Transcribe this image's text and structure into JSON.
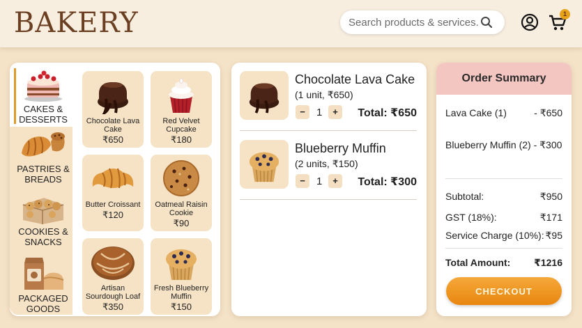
{
  "header": {
    "logo": "BAKERY",
    "search_placeholder": "Search products & services...",
    "cart_count": "1",
    "icons": {
      "search": "search-icon",
      "account": "user-circle-icon",
      "cart": "cart-icon"
    }
  },
  "categories": [
    {
      "label_line1": "CAKES &",
      "label_line2": "DESSERTS",
      "icon": "cake-icon",
      "active": true
    },
    {
      "label_line1": "PASTRIES &",
      "label_line2": "BREADS",
      "icon": "croissant-icon"
    },
    {
      "label_line1": "COOKIES &",
      "label_line2": "SNACKS",
      "icon": "cookie-box-icon"
    },
    {
      "label_line1": "PACKAGED",
      "label_line2": "GOODS",
      "icon": "package-icon"
    }
  ],
  "products": [
    {
      "name_line1": "Chocolate Lava",
      "name_line2": "Cake",
      "price": "₹650",
      "icon": "lava-cake-icon"
    },
    {
      "name_line1": "Red Velvet",
      "name_line2": "Cupcake",
      "price": "₹180",
      "icon": "cupcake-icon"
    },
    {
      "name_line1": "Butter Croissant",
      "name_line2": "",
      "price": "₹120",
      "icon": "croissant-icon"
    },
    {
      "name_line1": "Oatmeal Raisin",
      "name_line2": "Cookie",
      "price": "₹90",
      "icon": "cookie-icon"
    },
    {
      "name_line1": "Artisan",
      "name_line2": "Sourdough Loaf",
      "price": "₹350",
      "icon": "bread-loaf-icon"
    },
    {
      "name_line1": "Fresh Blueberry",
      "name_line2": "Muffin",
      "price": "₹150",
      "icon": "muffin-icon"
    }
  ],
  "cart_items": [
    {
      "name": "Chocolate Lava Cake",
      "detail": "(1 unit, ₹650)",
      "qty": "1",
      "total": "Total: ₹650",
      "minus": "−",
      "plus": "+"
    },
    {
      "name": "Blueberry Muffin",
      "detail": "(2 units, ₹150)",
      "qty": "1",
      "total": "Total: ₹300",
      "minus": "−",
      "plus": "+"
    }
  ],
  "summary": {
    "title": "Order Summary",
    "items": [
      {
        "label": "Lava Cake (1)",
        "value": "- ₹650"
      },
      {
        "label": "Blueberry Muffin (2) - ₹300",
        "value": ""
      }
    ],
    "subtotal_label": "Subtotal:",
    "subtotal_value": "₹950",
    "gst_label": "GST (18%):",
    "gst_value": "₹171",
    "service_label": "Service Charge (10%):",
    "service_value": "₹95",
    "total_label": "Total Amount:",
    "total_value": "₹1216",
    "checkout_label": "CHECKOUT"
  },
  "colors": {
    "accent": "#e8860f",
    "background": "#f5e3c8",
    "summary_header": "#f4c6c2",
    "logo": "#6b3f22"
  }
}
